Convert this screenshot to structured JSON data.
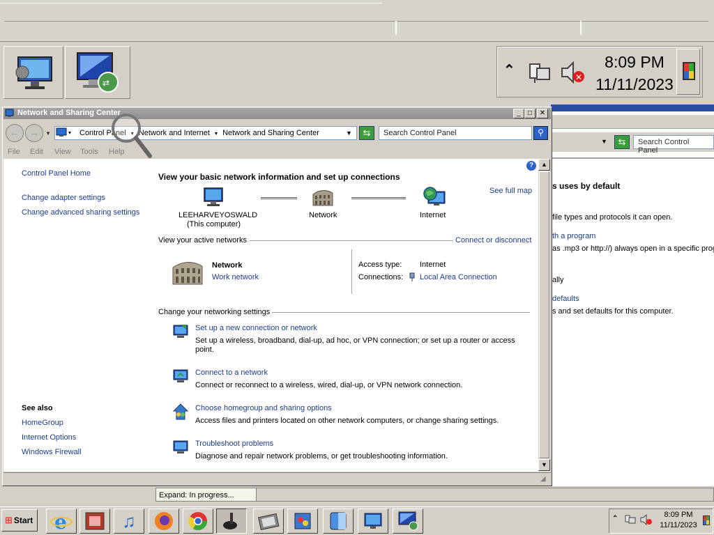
{
  "magnifier": {
    "time": "8:09 PM",
    "date": "11/11/2023"
  },
  "window": {
    "title": "Network and Sharing Center",
    "breadcrumb": [
      "Control Panel",
      "Network and Internet",
      "Network and Sharing Center"
    ],
    "search_placeholder": "Search Control Panel",
    "menu": [
      "File",
      "Edit",
      "View",
      "Tools",
      "Help"
    ]
  },
  "sidebar": {
    "home": "Control Panel Home",
    "links": [
      "Change adapter settings",
      "Change advanced sharing settings"
    ],
    "see_also_title": "See also",
    "see_also": [
      "HomeGroup",
      "Internet Options",
      "Windows Firewall"
    ]
  },
  "main": {
    "heading": "View your basic network information and set up connections",
    "see_full_map": "See full map",
    "map": {
      "computer_name": "LEEHARVEYOSWALD",
      "computer_sub": "(This computer)",
      "network": "Network",
      "internet": "Internet"
    },
    "active_title": "View your active networks",
    "connect_disconnect": "Connect or disconnect",
    "active_network": {
      "name": "Network",
      "type": "Work network",
      "access_type_label": "Access type:",
      "access_type_value": "Internet",
      "connections_label": "Connections:",
      "connections_value": "Local Area Connection"
    },
    "settings_title": "Change your networking settings",
    "tasks": [
      {
        "title": "Set up a new connection or network",
        "desc1": "Set up a wireless, broadband, dial-up, ad hoc, or VPN connection; or set up a router or access",
        "desc2": "point."
      },
      {
        "title": "Connect to a network",
        "desc1": "Connect or reconnect to a wireless, wired, dial-up, or VPN network connection.",
        "desc2": ""
      },
      {
        "title": "Choose homegroup and sharing options",
        "desc1": "Access files and printers located on other network computers, or change sharing settings.",
        "desc2": ""
      },
      {
        "title": "Troubleshoot problems",
        "desc1": "Diagnose and repair network problems, or get troubleshooting information.",
        "desc2": ""
      }
    ]
  },
  "background_window": {
    "search_placeholder": "Search Control Panel",
    "lines": [
      "s uses by default",
      "file types and protocols it can open.",
      "th a program",
      "as .mp3 or http://) always open in a specific prog",
      "ally",
      "defaults",
      "s and set defaults for this computer."
    ]
  },
  "tooltip": "Expand:  In progress...",
  "taskbar": {
    "start": "Start",
    "time": "8:09 PM",
    "date": "11/11/2023"
  },
  "colors": {
    "link": "#1b3c8c",
    "titlebar_inactive": "#9a9a9a",
    "window_face": "#d4d0c8"
  }
}
